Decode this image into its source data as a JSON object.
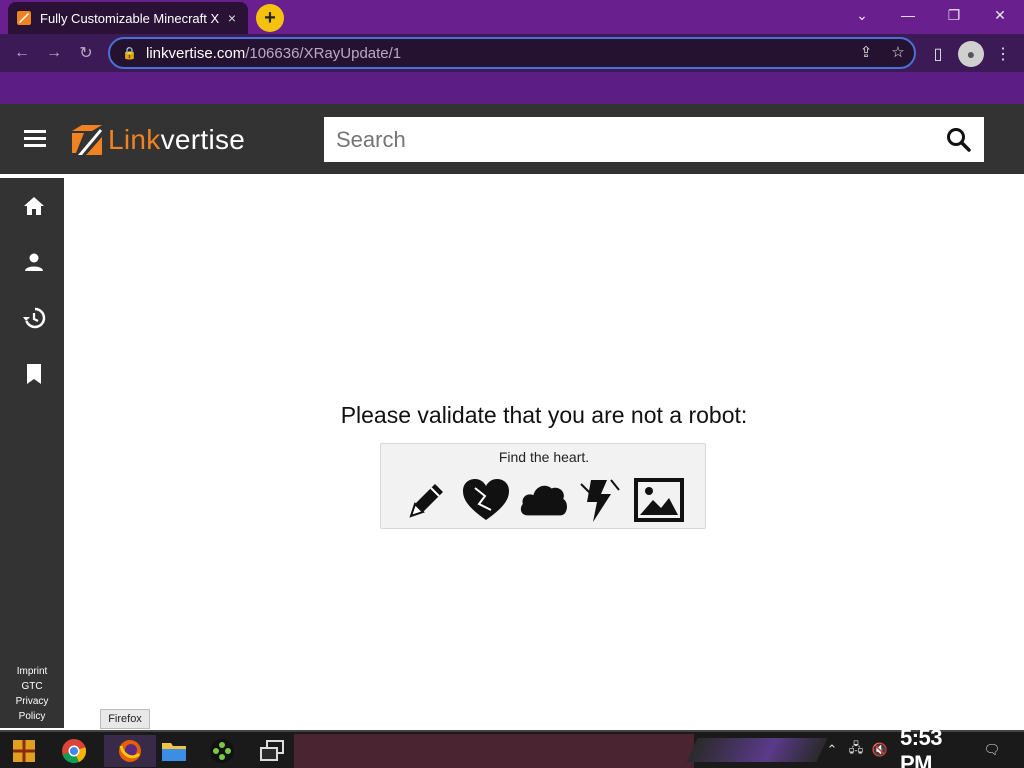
{
  "browser": {
    "tab_title": "Fully Customizable Minecraft X",
    "tab_close_icon": "×",
    "new_tab_label": "+",
    "url_host": "linkvertise.com",
    "url_path": "/106636/XRayUpdate/1"
  },
  "site": {
    "brand_link": "Link",
    "brand_vertise": "vertise",
    "search_placeholder": "Search",
    "accent_color": "#f08222",
    "header_bg": "#333333"
  },
  "sidebar": {
    "items": [
      {
        "icon": "home-icon"
      },
      {
        "icon": "person-icon"
      },
      {
        "icon": "history-icon"
      },
      {
        "icon": "bookmark-icon"
      }
    ],
    "footer_links": [
      "Imprint",
      "GTC",
      "Privacy",
      "Policy"
    ]
  },
  "main": {
    "heading": "Please validate that you are not a robot:",
    "captcha_prompt": "Find the heart.",
    "captcha_options": [
      "pencil-icon",
      "heart-icon",
      "cloud-icon",
      "lightning-icon",
      "image-icon"
    ]
  },
  "taskbar": {
    "tooltip": "Firefox",
    "clock": "5:53 PM"
  }
}
